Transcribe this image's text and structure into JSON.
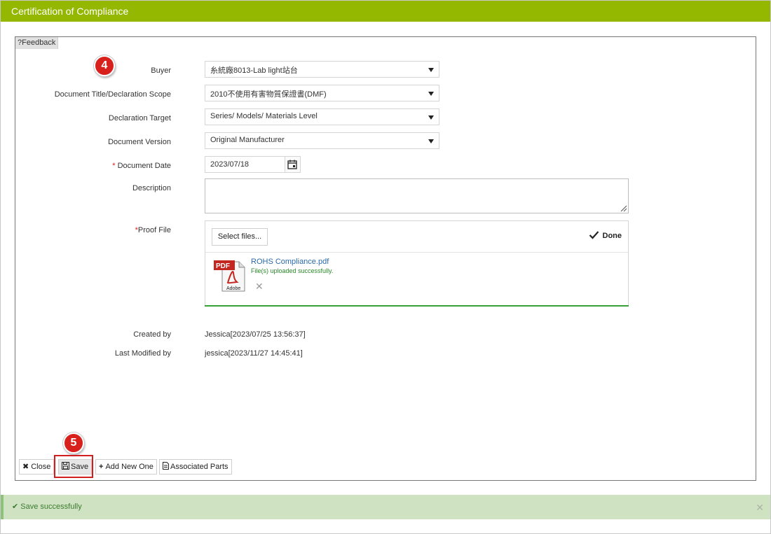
{
  "window": {
    "title": "Certification of Compliance"
  },
  "feedback": {
    "label": "?Feedback"
  },
  "steps": {
    "step4": "4",
    "step5": "5"
  },
  "form": {
    "buyer": {
      "label": "Buyer",
      "value": "糸統廠8013-Lab light站台"
    },
    "doc_title": {
      "label": "Document Title/Declaration Scope",
      "value": "2010不使用有害物質保證書(DMF)"
    },
    "decl_target": {
      "label": "Declaration Target",
      "value": "Series/ Models/ Materials Level"
    },
    "doc_version": {
      "label": "Document Version",
      "value": "Original Manufacturer"
    },
    "doc_date": {
      "required_mark": "*",
      "label": "Document Date",
      "value": "2023/07/18"
    },
    "description": {
      "label": "Description",
      "value": ""
    },
    "proof_file": {
      "required_mark": "*",
      "label": "Proof File",
      "select_button": "Select files...",
      "done_label": "Done",
      "file_name": "ROHS Compliance.pdf",
      "file_status": "File(s) uploaded successfully."
    },
    "created_by": {
      "label": "Created by",
      "value": "Jessica[2023/07/25 13:56:37]"
    },
    "modified_by": {
      "label": "Last Modified by",
      "value": "jessica[2023/11/27 14:45:41]"
    }
  },
  "toolbar": {
    "close": "Close",
    "save": "Save",
    "add_new": "Add New One",
    "associated_parts": "Associated Parts"
  },
  "toast": {
    "message": "Save successfully"
  },
  "colors": {
    "titlebar": "#94b800",
    "badge": "#d8211c",
    "upload_success": "#37a137",
    "toast_bg": "#cfe3c3",
    "link": "#2b6aa8"
  }
}
